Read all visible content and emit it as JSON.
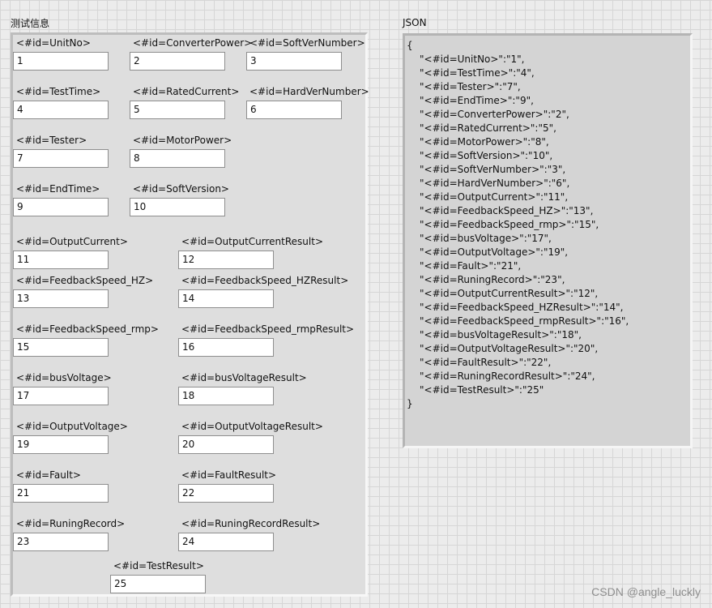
{
  "test_info": {
    "title": "测试信息",
    "fields": [
      {
        "label": "<#id=UnitNo>",
        "value": "1"
      },
      {
        "label": "<#id=ConverterPower>",
        "value": "2"
      },
      {
        "label": "<#id=SoftVerNumber>",
        "value": "3"
      },
      {
        "label": "<#id=TestTime>",
        "value": "4"
      },
      {
        "label": "<#id=RatedCurrent>",
        "value": "5"
      },
      {
        "label": "<#id=HardVerNumber>",
        "value": "6"
      },
      {
        "label": "<#id=Tester>",
        "value": "7"
      },
      {
        "label": "<#id=MotorPower>",
        "value": "8"
      },
      {
        "label": "<#id=EndTime>",
        "value": "9"
      },
      {
        "label": "<#id=SoftVersion>",
        "value": "10"
      },
      {
        "label": "<#id=OutputCurrent>",
        "value": "11"
      },
      {
        "label": "<#id=OutputCurrentResult>",
        "value": "12"
      },
      {
        "label": "<#id=FeedbackSpeed_HZ>",
        "value": "13"
      },
      {
        "label": "<#id=FeedbackSpeed_HZResult>",
        "value": "14"
      },
      {
        "label": "<#id=FeedbackSpeed_rmp>",
        "value": "15"
      },
      {
        "label": "<#id=FeedbackSpeed_rmpResult>",
        "value": "16"
      },
      {
        "label": "<#id=busVoltage>",
        "value": "17"
      },
      {
        "label": "<#id=busVoltageResult>",
        "value": "18"
      },
      {
        "label": "<#id=OutputVoltage>",
        "value": "19"
      },
      {
        "label": "<#id=OutputVoltageResult>",
        "value": "20"
      },
      {
        "label": "<#id=Fault>",
        "value": "21"
      },
      {
        "label": "<#id=FaultResult>",
        "value": "22"
      },
      {
        "label": "<#id=RuningRecord>",
        "value": "23"
      },
      {
        "label": "<#id=RuningRecordResult>",
        "value": "24"
      },
      {
        "label": "<#id=TestResult>",
        "value": "25"
      }
    ]
  },
  "json_panel": {
    "title": "JSON",
    "lines": [
      "{",
      "\"<#id=UnitNo>\":\"1\",",
      "\"<#id=TestTime>\":\"4\",",
      "\"<#id=Tester>\":\"7\",",
      "\"<#id=EndTime>\":\"9\",",
      "\"<#id=ConverterPower>\":\"2\",",
      "\"<#id=RatedCurrent>\":\"5\",",
      "\"<#id=MotorPower>\":\"8\",",
      "\"<#id=SoftVersion>\":\"10\",",
      "\"<#id=SoftVerNumber>\":\"3\",",
      "\"<#id=HardVerNumber>\":\"6\",",
      "\"<#id=OutputCurrent>\":\"11\",",
      "\"<#id=FeedbackSpeed_HZ>\":\"13\",",
      "\"<#id=FeedbackSpeed_rmp>\":\"15\",",
      "\"<#id=busVoltage>\":\"17\",",
      "\"<#id=OutputVoltage>\":\"19\",",
      "\"<#id=Fault>\":\"21\",",
      "\"<#id=RuningRecord>\":\"23\",",
      "\"<#id=OutputCurrentResult>\":\"12\",",
      "\"<#id=FeedbackSpeed_HZResult>\":\"14\",",
      "\"<#id=FeedbackSpeed_rmpResult>\":\"16\",",
      "\"<#id=busVoltageResult>\":\"18\",",
      "\"<#id=OutputVoltageResult>\":\"20\",",
      "\"<#id=FaultResult>\":\"22\",",
      "\"<#id=RuningRecordResult>\":\"24\",",
      "\"<#id=TestResult>\":\"25\"",
      "}"
    ]
  },
  "watermark": "CSDN @angle_luckly",
  "colors": {
    "panel_bg": "#dedede",
    "json_bg": "#d4d4d4",
    "input_bg": "#ffffff"
  }
}
